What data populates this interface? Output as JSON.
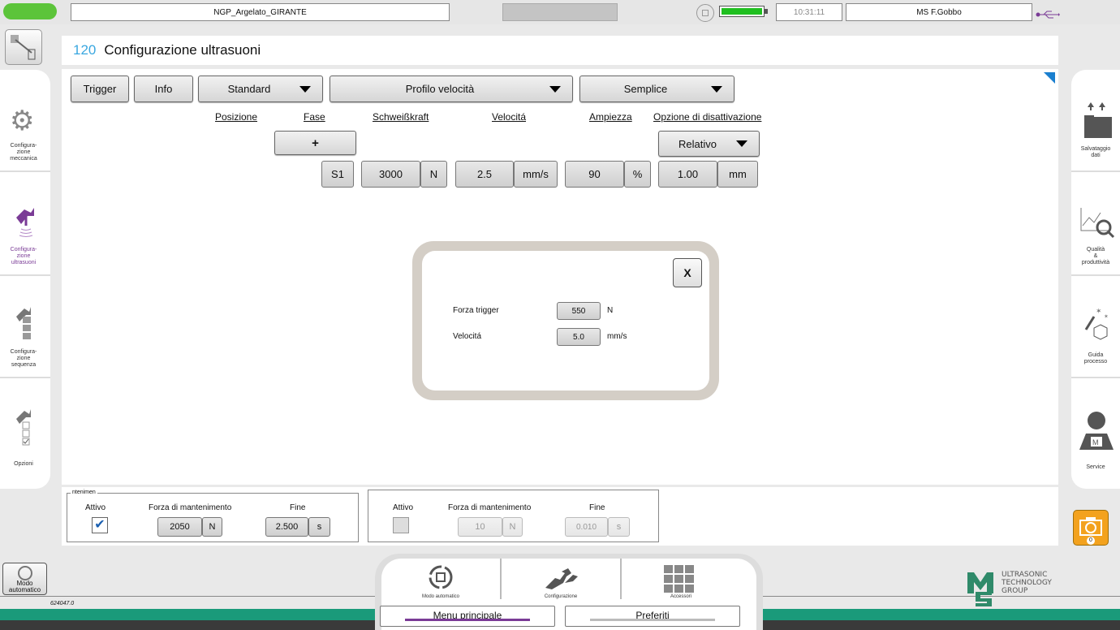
{
  "topbar": {
    "project_name": "NGP_Argelato_GIRANTE",
    "time": "10:31:11",
    "user": "MS F.Gobbo",
    "battery_level": 1.0
  },
  "page": {
    "number": "120",
    "title": "Configurazione ultrasuoni"
  },
  "toolbar": {
    "trigger_label": "Trigger",
    "info_label": "Info",
    "mode_select": "Standard",
    "profile_select": "Profilo velocità",
    "type_select": "Semplice"
  },
  "columns": {
    "posizione": "Posizione",
    "fase": "Fase",
    "schweisskraft": "Schweißkraft",
    "velocita": "Velocitá",
    "ampiezza": "Ampiezza",
    "opzione": "Opzione di disattivazione"
  },
  "row": {
    "add_label": "+",
    "relativo_select": "Relativo",
    "step": "S1",
    "force_value": "3000",
    "force_unit": "N",
    "speed_value": "2.5",
    "speed_unit": "mm/s",
    "amplitude_value": "90",
    "amplitude_unit": "%",
    "deactivation_value": "1.00",
    "deactivation_unit": "mm"
  },
  "dialog": {
    "close_label": "X",
    "trigger_force_label": "Forza trigger",
    "trigger_force_value": "550",
    "trigger_force_unit": "N",
    "speed_label": "Velocitá",
    "speed_value": "5.0",
    "speed_unit": "mm/s"
  },
  "holding": {
    "legend": "ntenimen",
    "group1": {
      "active_label": "Attivo",
      "active_checked": true,
      "force_label": "Forza di mantenimento",
      "force_value": "2050",
      "force_unit": "N",
      "end_label": "Fine",
      "end_value": "2.500",
      "end_unit": "s"
    },
    "group2": {
      "active_label": "Attivo",
      "active_checked": false,
      "force_label": "Forza di mantenimento",
      "force_value": "10",
      "force_unit": "N",
      "end_label": "Fine",
      "end_value": "0.010",
      "end_unit": "s"
    }
  },
  "left_nav": {
    "items": [
      {
        "label": "Configura-\nzione\nmeccanica",
        "icon": "gear-icon"
      },
      {
        "label": "Configura-\nzione\nultrasuoni",
        "icon": "ultrasound-tool-icon",
        "active": true
      },
      {
        "label": "Configura-\nzione\nsequenza",
        "icon": "sequence-icon"
      },
      {
        "label": "Opzioni",
        "icon": "options-icon"
      }
    ]
  },
  "right_nav": {
    "items": [
      {
        "label": "Salvataggio\ndati",
        "icon": "save-data-icon"
      },
      {
        "label": "Qualità\n&\nproduttività",
        "icon": "quality-icon"
      },
      {
        "label": "Guida\nprocesso",
        "icon": "wizard-icon"
      },
      {
        "label": "Service",
        "icon": "service-icon"
      }
    ],
    "camera_count": "0"
  },
  "footer": {
    "mode_button": "Modo\nautomatico",
    "version": "624047.0",
    "nav_modo": "Modo automatico",
    "nav_config": "Configurazione",
    "nav_accessori": "Accessori",
    "menu_principale": "Menu principale",
    "preferiti": "Preferiti",
    "brand_line1": "ULTRASONIC",
    "brand_line2": "TECHNOLOGY",
    "brand_line3": "GROUP"
  },
  "colors": {
    "accent_blue": "#3aa7e0",
    "active_purple": "#7a3b96",
    "status_green": "#5cc43a",
    "footer_teal": "#1a9a7a"
  }
}
